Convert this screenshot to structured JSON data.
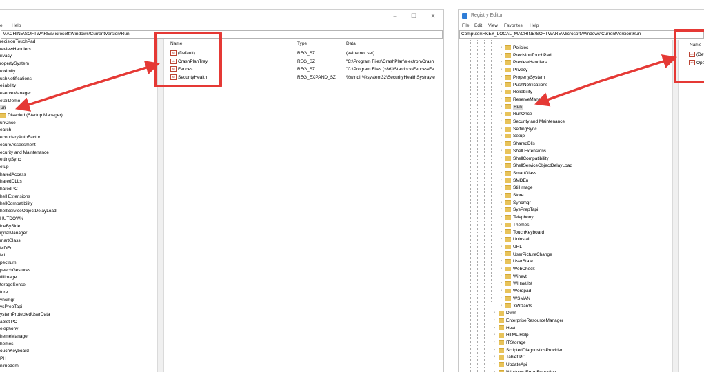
{
  "left": {
    "menu": [
      "e",
      "Help"
    ],
    "address": "MACHINE\\SOFTWARE\\Microsoft\\Windows\\CurrentVersion\\Run",
    "columns": {
      "name": "Name",
      "type": "Type",
      "data": "Data"
    },
    "values": [
      {
        "name": "(Default)",
        "type": "REG_SZ",
        "data": "(value not set)"
      },
      {
        "name": "CrashPlanTray",
        "type": "REG_SZ",
        "data": "\"C:\\Program Files\\CrashPlan\\electron\\Crash"
      },
      {
        "name": "Fences",
        "type": "REG_SZ",
        "data": "\"C:\\Program Files (x86)\\Stardock\\Fences\\Fe"
      },
      {
        "name": "SecurityHealth",
        "type": "REG_EXPAND_SZ",
        "data": "%windir%\\system32\\SecurityHealthSystray.e"
      }
    ],
    "tree": [
      "recisionTouchPad",
      "reviewHandlers",
      "rivacy",
      "ropertySystem",
      "roximity",
      "ushNotifications",
      "eliability",
      "eserveManager",
      "etailDemo",
      "un",
      "Disabled (Startup Manager)",
      "unOnce",
      "earch",
      "econdaryAuthFactor",
      "ecureAssessment",
      "ecurity and Maintenance",
      "ettingSync",
      "etup",
      "haredAccess",
      "haredDLLs",
      "haredPC",
      "hell Extensions",
      "hellCompatibility",
      "hellServiceObjectDelayLoad",
      "HUTDOWN",
      "ideBySide",
      "ignalManager",
      "martGlass",
      "MDEn",
      "MI",
      "pectrum",
      "peechGestures",
      "tillImage",
      "torageSense",
      "tore",
      "yncmgr",
      "ysPrepTapi",
      "ystemProtectedUserData",
      "ablet PC",
      "elephony",
      "hemeManager",
      "hemes",
      "ouchKeyboard",
      "PH",
      "nimodem"
    ]
  },
  "right": {
    "title": "Registry Editor",
    "menu": [
      "File",
      "Edit",
      "View",
      "Favorites",
      "Help"
    ],
    "address": "Computer\\HKEY_LOCAL_MACHINE\\SOFTWARE\\Microsoft\\Windows\\CurrentVersion\\Run",
    "columns": {
      "name": "Name"
    },
    "values": [
      {
        "name": "(Def"
      },
      {
        "name": "Ope"
      }
    ],
    "tree": [
      "Policies",
      "PrecisionTouchPad",
      "PreviewHandlers",
      "Privacy",
      "PropertySystem",
      "PushNotifications",
      "Reliability",
      "ReserveManager",
      "Run",
      "RunOnce",
      "Security and Maintenance",
      "SettingSync",
      "Setup",
      "SharedDlls",
      "Shell Extensions",
      "ShellCompatibility",
      "ShellServiceObjectDelayLoad",
      "SmartGlass",
      "SMDEn",
      "StillImage",
      "Store",
      "Syncmgr",
      "SysPrepTapi",
      "Telephony",
      "Themes",
      "TouchKeyboard",
      "Uninstall",
      "URL",
      "UserPictureChange",
      "UserState",
      "WebCheck",
      "Winevt",
      "Winsatlist",
      "Wordpad",
      "WSMAN",
      "XWizards",
      "Dwm",
      "EnterpriseResourceManager",
      "Heat",
      "HTML Help",
      "ITStorage",
      "ScriptedDiagnosticsProvider",
      "Tablet PC",
      "UpdateApi",
      "Windows Error Reporting"
    ]
  },
  "colors": {
    "highlight": "#e53935",
    "folder": "#e8c35a",
    "selected_bg": "#d9d9d9"
  }
}
